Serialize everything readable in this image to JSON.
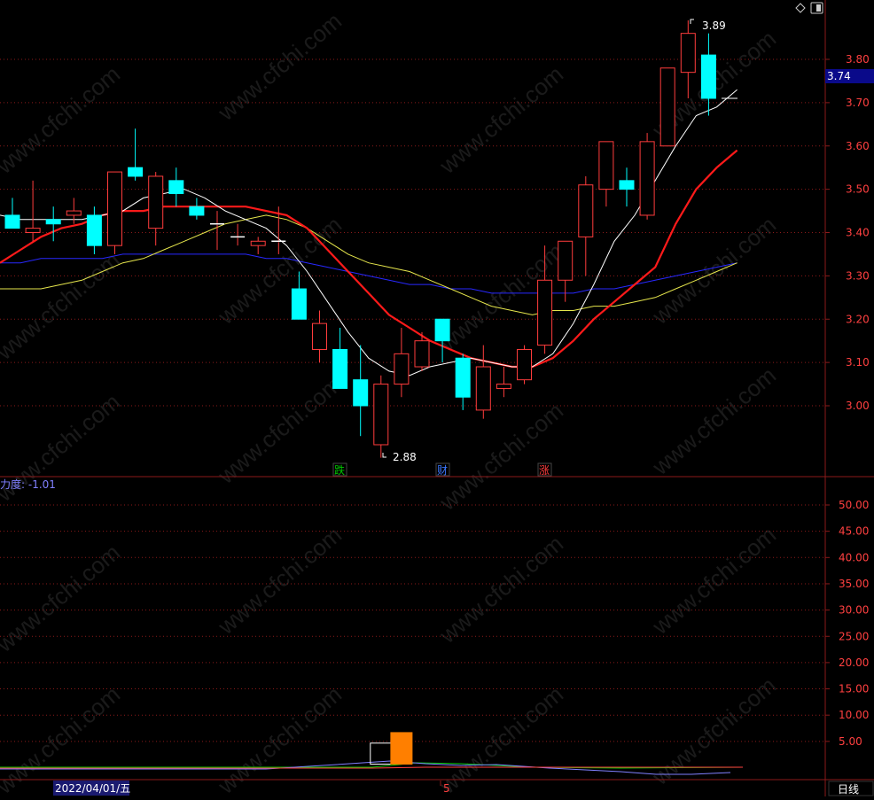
{
  "watermark": "www.cfchi.com",
  "toolbar": {
    "diamond_icon": "diamond-icon",
    "window_icon": "window-icon"
  },
  "price_axis": {
    "ticks": [
      "3.80",
      "3.70",
      "3.60",
      "3.50",
      "3.40",
      "3.30",
      "3.20",
      "3.10",
      "3.00"
    ],
    "current_price": "3.74"
  },
  "price_annotations": {
    "high": "3.89",
    "low": "2.88"
  },
  "event_markers": [
    {
      "label": "跌",
      "color": "#00c800"
    },
    {
      "label": "财",
      "color": "#3c78ff"
    },
    {
      "label": "涨",
      "color": "#ff3c3c"
    }
  ],
  "indicator": {
    "title": "力度: -1.01",
    "ticks": [
      "50.00",
      "45.00",
      "40.00",
      "35.00",
      "30.00",
      "25.00",
      "20.00",
      "15.00",
      "10.00",
      "5.00"
    ]
  },
  "time_axis": {
    "date_label": "2022/04/01/五",
    "month_label": "5",
    "period_button": "日线"
  },
  "colors": {
    "up": "#ff3c3c",
    "down": "#00ffff",
    "ma_white": "#ffffff",
    "ma_red": "#ff1a1a",
    "ma_yellow": "#e6e64c",
    "ma_blue": "#2828ff",
    "grid": "#8b1a1a"
  },
  "chart_data": {
    "type": "candlestick",
    "ylim": [
      2.88,
      3.89
    ],
    "candles": [
      {
        "o": 3.44,
        "h": 3.48,
        "l": 3.41,
        "c": 3.41
      },
      {
        "o": 3.4,
        "h": 3.52,
        "l": 3.38,
        "c": 3.41
      },
      {
        "o": 3.43,
        "h": 3.46,
        "l": 3.38,
        "c": 3.42
      },
      {
        "o": 3.44,
        "h": 3.48,
        "l": 3.42,
        "c": 3.45
      },
      {
        "o": 3.44,
        "h": 3.46,
        "l": 3.35,
        "c": 3.37
      },
      {
        "o": 3.37,
        "h": 3.54,
        "l": 3.35,
        "c": 3.54
      },
      {
        "o": 3.55,
        "h": 3.64,
        "l": 3.52,
        "c": 3.53
      },
      {
        "o": 3.41,
        "h": 3.54,
        "l": 3.37,
        "c": 3.53
      },
      {
        "o": 3.52,
        "h": 3.55,
        "l": 3.46,
        "c": 3.49
      },
      {
        "o": 3.46,
        "h": 3.48,
        "l": 3.43,
        "c": 3.44
      },
      {
        "o": 3.42,
        "h": 3.45,
        "l": 3.36,
        "c": 3.42
      },
      {
        "o": 3.39,
        "h": 3.42,
        "l": 3.37,
        "c": 3.39
      },
      {
        "o": 3.37,
        "h": 3.39,
        "l": 3.35,
        "c": 3.38
      },
      {
        "o": 3.38,
        "h": 3.46,
        "l": 3.35,
        "c": 3.38
      },
      {
        "o": 3.27,
        "h": 3.31,
        "l": 3.2,
        "c": 3.2
      },
      {
        "o": 3.13,
        "h": 3.22,
        "l": 3.1,
        "c": 3.19
      },
      {
        "o": 3.13,
        "h": 3.18,
        "l": 3.04,
        "c": 3.04
      },
      {
        "o": 3.06,
        "h": 3.14,
        "l": 2.93,
        "c": 3.0
      },
      {
        "o": 2.91,
        "h": 3.07,
        "l": 2.88,
        "c": 3.05
      },
      {
        "o": 3.05,
        "h": 3.18,
        "l": 3.02,
        "c": 3.12
      },
      {
        "o": 3.09,
        "h": 3.17,
        "l": 3.08,
        "c": 3.15
      },
      {
        "o": 3.2,
        "h": 3.2,
        "l": 3.1,
        "c": 3.15
      },
      {
        "o": 3.11,
        "h": 3.12,
        "l": 2.99,
        "c": 3.02
      },
      {
        "o": 2.99,
        "h": 3.14,
        "l": 2.97,
        "c": 3.09
      },
      {
        "o": 3.04,
        "h": 3.09,
        "l": 3.02,
        "c": 3.05
      },
      {
        "o": 3.06,
        "h": 3.14,
        "l": 3.05,
        "c": 3.13
      },
      {
        "o": 3.14,
        "h": 3.37,
        "l": 3.12,
        "c": 3.29
      },
      {
        "o": 3.29,
        "h": 3.38,
        "l": 3.24,
        "c": 3.38
      },
      {
        "o": 3.39,
        "h": 3.53,
        "l": 3.3,
        "c": 3.51
      },
      {
        "o": 3.5,
        "h": 3.61,
        "l": 3.46,
        "c": 3.61
      },
      {
        "o": 3.52,
        "h": 3.55,
        "l": 3.46,
        "c": 3.5
      },
      {
        "o": 3.44,
        "h": 3.63,
        "l": 3.43,
        "c": 3.61
      },
      {
        "o": 3.6,
        "h": 3.78,
        "l": 3.6,
        "c": 3.78
      },
      {
        "o": 3.77,
        "h": 3.89,
        "l": 3.71,
        "c": 3.86
      },
      {
        "o": 3.81,
        "h": 3.86,
        "l": 3.67,
        "c": 3.71
      }
    ],
    "ma_white": [
      3.44,
      3.43,
      3.43,
      3.43,
      3.43,
      3.44,
      3.45,
      3.48,
      3.49,
      3.5,
      3.48,
      3.45,
      3.43,
      3.41,
      3.37,
      3.31,
      3.24,
      3.17,
      3.11,
      3.08,
      3.07,
      3.09,
      3.1,
      3.11,
      3.1,
      3.09,
      3.09,
      3.12,
      3.19,
      3.28,
      3.38,
      3.44,
      3.52,
      3.6,
      3.67,
      3.69,
      3.73
    ],
    "ma_red": [
      3.33,
      3.36,
      3.39,
      3.41,
      3.42,
      3.44,
      3.45,
      3.45,
      3.46,
      3.46,
      3.46,
      3.46,
      3.46,
      3.45,
      3.44,
      3.41,
      3.36,
      3.31,
      3.26,
      3.21,
      3.18,
      3.15,
      3.13,
      3.11,
      3.1,
      3.09,
      3.09,
      3.11,
      3.15,
      3.2,
      3.24,
      3.28,
      3.32,
      3.42,
      3.5,
      3.55,
      3.59
    ],
    "ma_yellow": [
      3.27,
      3.27,
      3.27,
      3.28,
      3.29,
      3.31,
      3.33,
      3.34,
      3.36,
      3.38,
      3.4,
      3.42,
      3.43,
      3.44,
      3.43,
      3.41,
      3.38,
      3.35,
      3.33,
      3.32,
      3.31,
      3.29,
      3.27,
      3.25,
      3.23,
      3.22,
      3.21,
      3.22,
      3.22,
      3.23,
      3.23,
      3.24,
      3.25,
      3.27,
      3.29,
      3.31,
      3.33
    ],
    "ma_blue": [
      3.33,
      3.33,
      3.34,
      3.34,
      3.34,
      3.34,
      3.35,
      3.35,
      3.35,
      3.35,
      3.35,
      3.35,
      3.35,
      3.34,
      3.34,
      3.33,
      3.32,
      3.31,
      3.3,
      3.29,
      3.28,
      3.28,
      3.27,
      3.27,
      3.26,
      3.26,
      3.26,
      3.26,
      3.26,
      3.27,
      3.27,
      3.28,
      3.29,
      3.3,
      3.31,
      3.32,
      3.33
    ],
    "indicator_bars": [
      {
        "index": 18,
        "value": 4.0,
        "color": "#ffffff",
        "fill": false
      },
      {
        "index": 19,
        "value": 6.0,
        "color": "#ff7f00",
        "fill": true
      }
    ],
    "indicator_ylim": [
      0,
      55
    ]
  }
}
